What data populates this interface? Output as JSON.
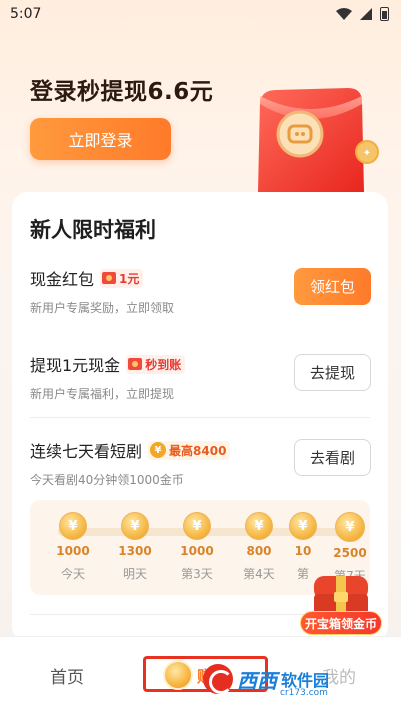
{
  "status_bar": {
    "time": "5:07"
  },
  "hero": {
    "title": "登录秒提现6.6元",
    "login_button": "立即登录"
  },
  "card": {
    "title": "新人限时福利",
    "tasks": [
      {
        "name": "现金红包",
        "badge": "1元",
        "desc": "新用户专属奖励，立即领取",
        "button": "领红包"
      },
      {
        "name": "提现1元现金",
        "badge": "秒到账",
        "desc": "新用户专属福利，立即提现",
        "button": "去提现"
      },
      {
        "name": "连续七天看短剧",
        "badge": "最高8400",
        "desc": "今天看剧40分钟领1000金币",
        "button": "去看剧"
      }
    ],
    "days": [
      {
        "amount": "1000",
        "label": "今天"
      },
      {
        "amount": "1300",
        "label": "明天"
      },
      {
        "amount": "1000",
        "label": "第3天"
      },
      {
        "amount": "800",
        "label": "第4天"
      },
      {
        "amount": "10",
        "label": "第"
      },
      {
        "amount": "2500",
        "label": "第7天"
      }
    ]
  },
  "treasure": {
    "label": "开宝箱领金币"
  },
  "tabbar": {
    "home": "首页",
    "active": "赚",
    "mine": "我的"
  },
  "watermark": {
    "brand": "西西",
    "site": "软件园",
    "url": "cr173.com"
  },
  "colors": {
    "accent": "#ff7a2a",
    "red": "#e83a2e"
  }
}
